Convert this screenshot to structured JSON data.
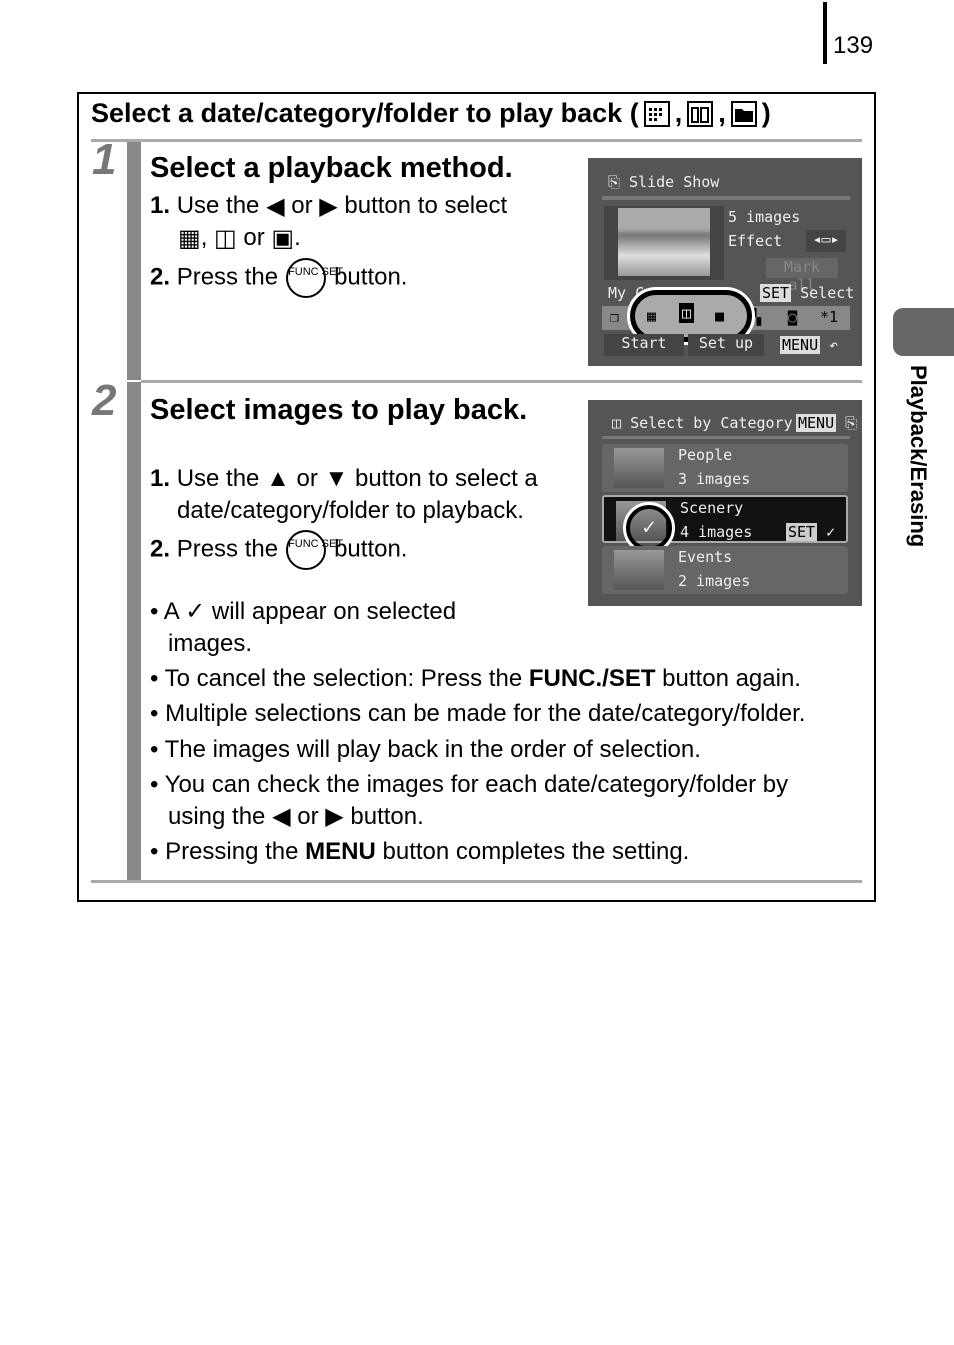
{
  "page_number": "139",
  "side_tab": "Playback/Erasing",
  "title": "Select a date/category/folder to play back (",
  "title_icons": [
    "date-grid-icon",
    "category-icon",
    "folder-icon"
  ],
  "step1": {
    "number": "1",
    "heading": "Select a playback method.",
    "item1_num": "1.",
    "item1_a": "Use the",
    "item1_or": "or",
    "item1_b": "button to select",
    "item1_sep1": ",",
    "item1_or2": "or",
    "item1_end": ".",
    "item2_num": "2.",
    "item2_a": "Press the",
    "item2_b": "button.",
    "screen": {
      "title": "Slide Show",
      "images": "5 images",
      "effect": "Effect",
      "mark_all": "Mark all",
      "my_category": "My Category",
      "set": "SET",
      "select": "Select",
      "start": "Start",
      "setup": "Set up",
      "menu": "MENU",
      "star": "*1"
    }
  },
  "step2": {
    "number": "2",
    "heading": "Select images to play back.",
    "item1_num": "1.",
    "item1_a": "Use the",
    "item1_or": "or",
    "item1_b": "button to select a",
    "item1_c": "date/category/folder to playback.",
    "item2_num": "2.",
    "item2_a": "Press the",
    "item2_b": "button.",
    "bullet1_a": "A",
    "bullet1_b": "will appear on selected",
    "bullet1_c": "images.",
    "bullet2_a": "To cancel the selection: Press the ",
    "bullet2_b": "FUNC./SET",
    "bullet2_c": " button again.",
    "bullet3": "Multiple selections can be made for the date/category/folder.",
    "bullet4": "The images will play back in the order of selection.",
    "bullet5_a": "You can check the images for each date/category/folder by",
    "bullet5_b": "using the",
    "bullet5_or": "or",
    "bullet5_c": "button.",
    "bullet6_a": "Pressing the ",
    "bullet6_b": "MENU",
    "bullet6_c": " button completes the setting.",
    "screen": {
      "title": "Select by Category",
      "menu": "MENU",
      "rows": [
        {
          "label": "People",
          "count": "3 images"
        },
        {
          "label": "Scenery",
          "count": "4 images"
        },
        {
          "label": "Events",
          "count": "2 images"
        }
      ],
      "set": "SET",
      "check": "✓"
    }
  },
  "func_label": "FUNC SET"
}
